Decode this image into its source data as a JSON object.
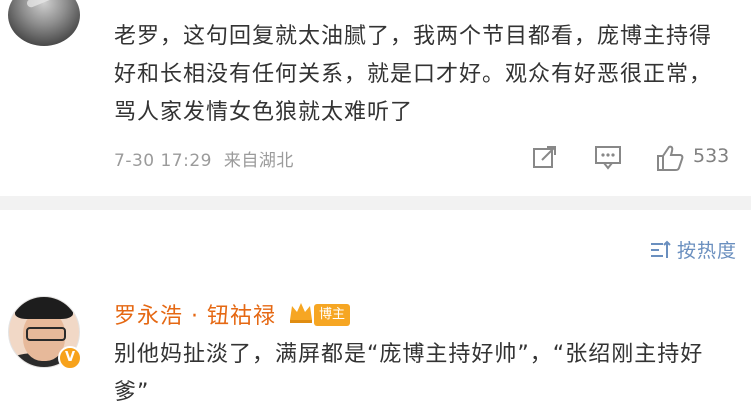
{
  "comment1": {
    "text": "老罗，这句回复就太油腻了，我两个节目都看，庞博主持得好和长相没有任何关系，就是口才好。观众有好恶很正常，骂人家发情女色狼就太难听了",
    "timestamp": "7-30 17:29",
    "location": "来自湖北",
    "like_count": "533",
    "icons": [
      "share-icon",
      "comment-icon",
      "like-icon"
    ]
  },
  "sort": {
    "label": "按热度",
    "icon": "sort-icon"
  },
  "comment2": {
    "username": "罗永浩 · 钮祜禄",
    "tag": "博主",
    "verified_badge": "V",
    "text": "别他妈扯淡了，满屏都是“庞博主持好帅”，“张绍刚主持好爹”"
  },
  "colors": {
    "username": "#e56813",
    "link": "#6a8fbf",
    "meta": "#9b9b9b",
    "divider": "#f2f2f2"
  }
}
